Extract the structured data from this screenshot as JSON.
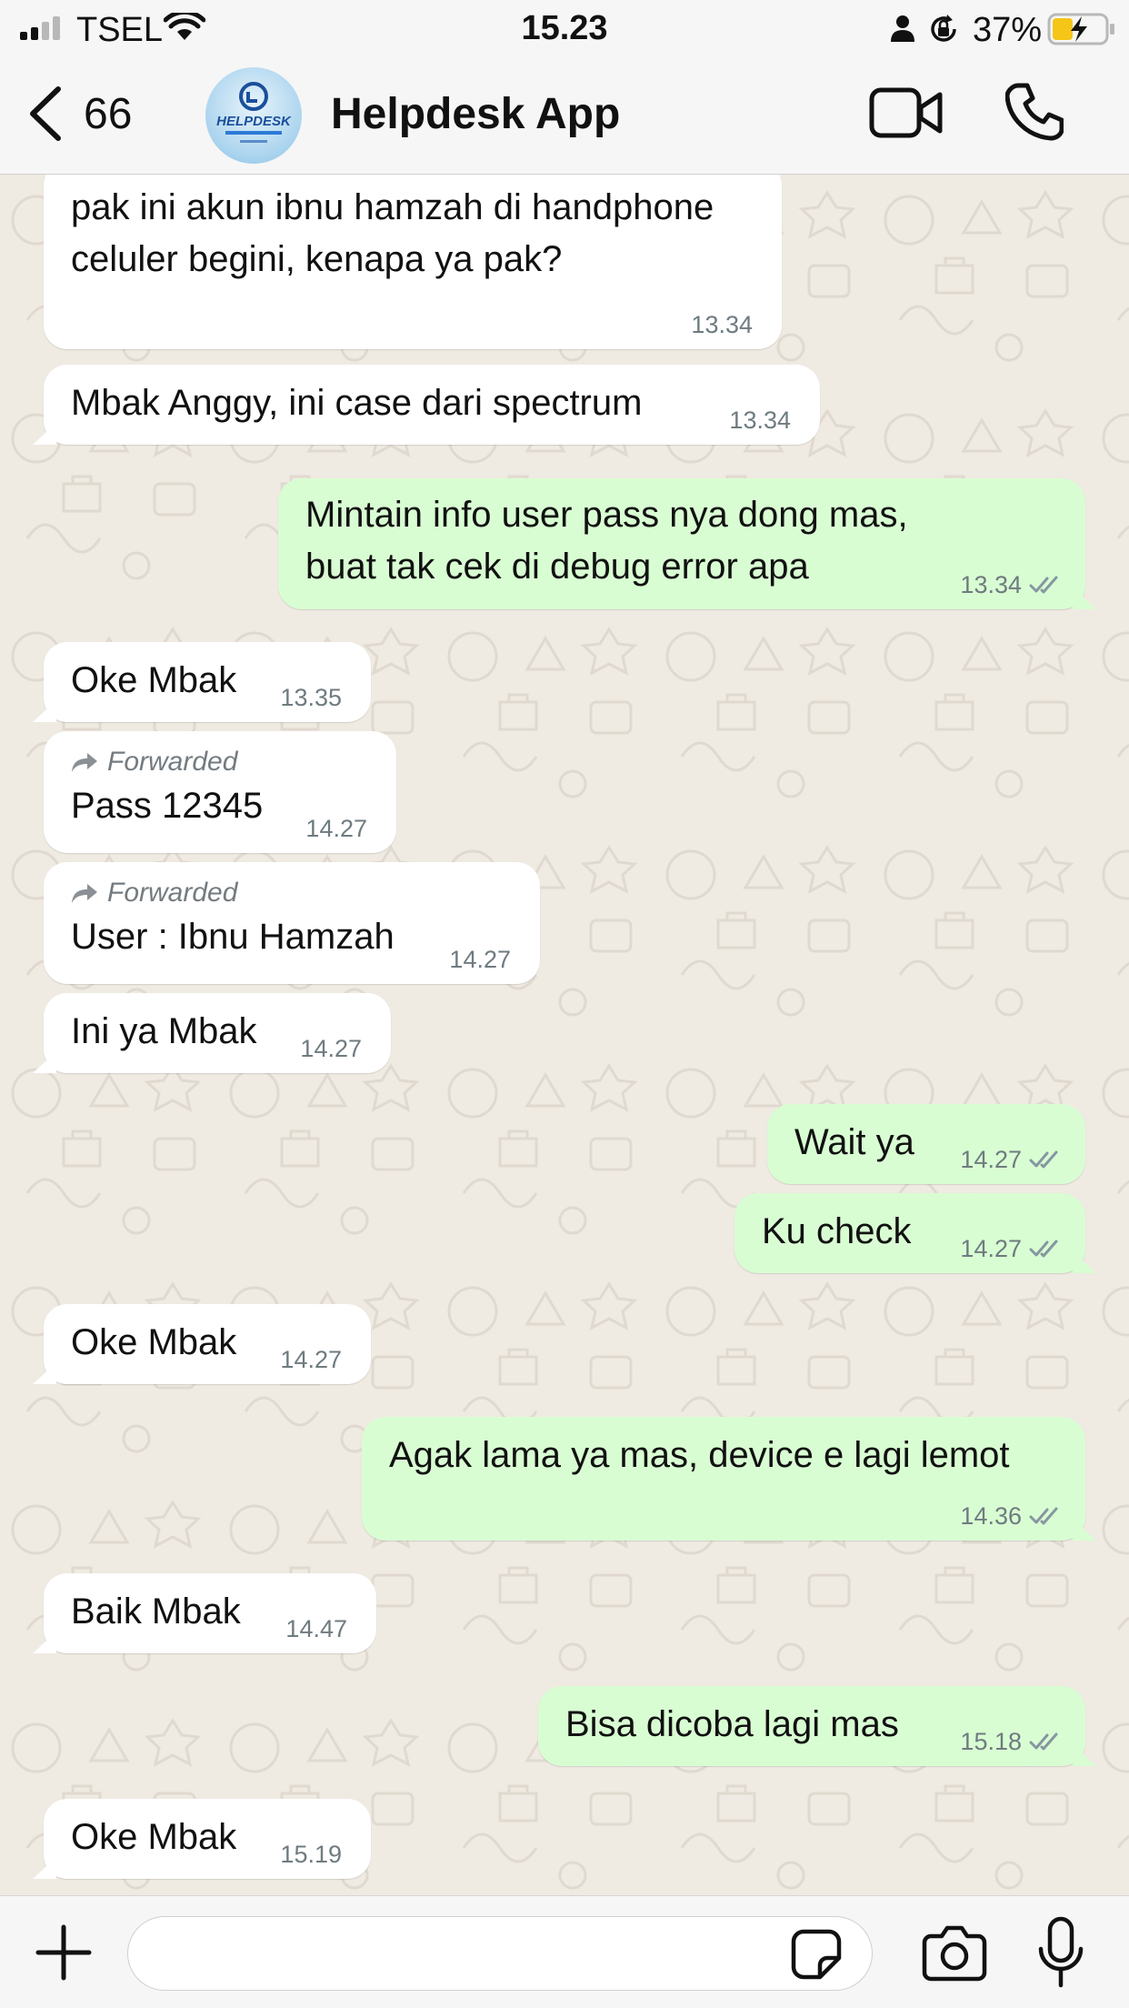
{
  "status_bar": {
    "carrier": "TSEL",
    "time": "15.23",
    "battery": "37%"
  },
  "header": {
    "back_count": "66",
    "title": "Helpdesk App",
    "avatar_text": "HELPDESK"
  },
  "colors": {
    "incoming": "#ffffff",
    "outgoing": "#d9fdd3",
    "wallpaper": "#efeae2",
    "tick": "#8696a0"
  },
  "messages": [
    {
      "dir": "in",
      "text": "pak ini akun ibnu hamzah di handphone celuler begini, kenapa ya pak?",
      "time": "13.34"
    },
    {
      "dir": "in",
      "text": "Mbak Anggy, ini case dari spectrum",
      "time": "13.34"
    },
    {
      "dir": "out",
      "text": "Mintain info user pass nya dong mas, buat tak cek di debug error apa",
      "time": "13.34",
      "read": true
    },
    {
      "dir": "in",
      "text": "Oke Mbak",
      "time": "13.35"
    },
    {
      "dir": "in",
      "forwarded": "Forwarded",
      "text": "Pass 12345",
      "time": "14.27"
    },
    {
      "dir": "in",
      "forwarded": "Forwarded",
      "text": "User : Ibnu Hamzah",
      "time": "14.27"
    },
    {
      "dir": "in",
      "text": "Ini ya Mbak",
      "time": "14.27"
    },
    {
      "dir": "out",
      "text": "Wait ya",
      "time": "14.27",
      "read": true
    },
    {
      "dir": "out",
      "text": "Ku check",
      "time": "14.27",
      "read": true
    },
    {
      "dir": "in",
      "text": "Oke Mbak",
      "time": "14.27"
    },
    {
      "dir": "out",
      "text": "Agak lama ya mas, device e lagi lemot",
      "time": "14.36",
      "read": true
    },
    {
      "dir": "in",
      "text": "Baik Mbak",
      "time": "14.47"
    },
    {
      "dir": "out",
      "text": "Bisa dicoba lagi mas",
      "time": "15.18",
      "read": true
    },
    {
      "dir": "in",
      "text": "Oke Mbak",
      "time": "15.19"
    }
  ],
  "input": {
    "value": "",
    "placeholder": ""
  }
}
